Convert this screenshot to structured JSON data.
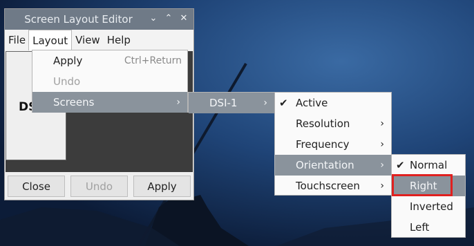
{
  "window": {
    "title": "Screen Layout Editor",
    "controls": [
      "⌄",
      "⌃",
      "✕"
    ]
  },
  "menubar": [
    "File",
    "Layout",
    "View",
    "Help"
  ],
  "canvas": {
    "screen_label": "DS"
  },
  "buttons": {
    "close": "Close",
    "undo": "Undo",
    "apply": "Apply"
  },
  "layout_menu": {
    "apply": "Apply",
    "apply_shortcut": "Ctrl+Return",
    "undo": "Undo",
    "screens": "Screens"
  },
  "screens_menu": {
    "dsi1": "DSI-1"
  },
  "dsi_menu": {
    "active": "Active",
    "resolution": "Resolution",
    "frequency": "Frequency",
    "orientation": "Orientation",
    "touchscreen": "Touchscreen"
  },
  "orientation_menu": {
    "normal": "Normal",
    "right": "Right",
    "inverted": "Inverted",
    "left": "Left"
  },
  "colors": {
    "highlight": "#8a939c",
    "titlebar": "#6f7a87",
    "annotation": "#e0201f"
  },
  "icons": {
    "check": "check-icon",
    "submenu": "chevron-right-icon"
  }
}
